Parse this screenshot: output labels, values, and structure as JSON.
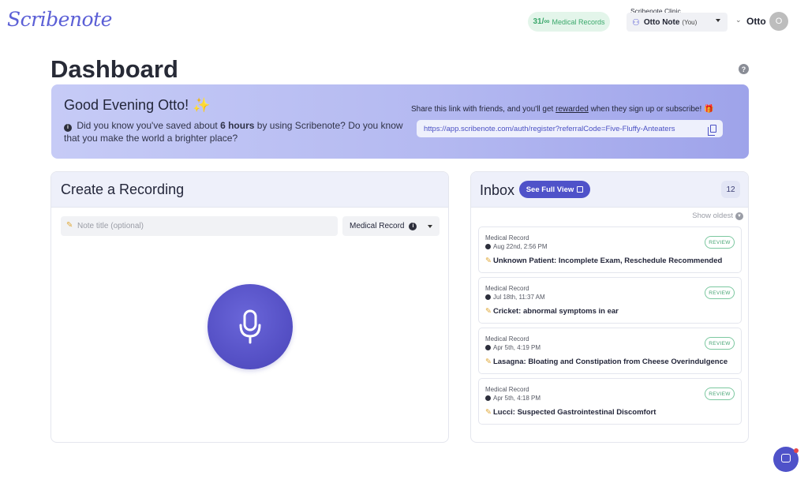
{
  "header": {
    "logo": "Scribenote",
    "records_count": "31/∞",
    "records_label": "Medical Records",
    "clinic_label": "Scribenote Clinic",
    "clinic_user": "Otto Note",
    "clinic_you": "(You)",
    "user_name": "Otto",
    "avatar_initial": "O"
  },
  "page": {
    "title": "Dashboard",
    "help_icon": "?"
  },
  "banner": {
    "greeting": "Good Evening Otto!",
    "greeting_emoji": "✨",
    "info_prefix": "Did you know you've saved about",
    "hours": "6 hours",
    "info_suffix": "by using Scribenote? Do you know that you make the world a brighter place?",
    "share_prefix": "Share this link with friends, and you'll get",
    "share_link_word": "rewarded",
    "share_suffix": "when they sign up or subscribe!",
    "gift_emoji": "🎁",
    "referral_url": "https://app.scribenote.com/auth/register?referralCode=Five-Fluffy-Anteaters"
  },
  "recording": {
    "title": "Create a Recording",
    "note_placeholder": "Note title (optional)",
    "record_type": "Medical Record"
  },
  "inbox": {
    "title": "Inbox",
    "full_view_label": "See Full View",
    "count": "12",
    "show_oldest": "Show oldest",
    "items": [
      {
        "type": "Medical Record",
        "date": "Aug 22nd, 2:56 PM",
        "title": "Unknown Patient: Incomplete Exam, Reschedule Recommended",
        "badge": "REVIEW"
      },
      {
        "type": "Medical Record",
        "date": "Jul 18th, 11:37 AM",
        "title": "Cricket: abnormal symptoms in ear",
        "badge": "REVIEW"
      },
      {
        "type": "Medical Record",
        "date": "Apr 5th, 4:19 PM",
        "title": "Lasagna: Bloating and Constipation from Cheese Overindulgence",
        "badge": "REVIEW"
      },
      {
        "type": "Medical Record",
        "date": "Apr 5th, 4:18 PM",
        "title": "Lucci: Suspected Gastrointestinal Discomfort",
        "badge": "REVIEW"
      }
    ]
  },
  "colors": {
    "brand": "#5b5fd6",
    "button": "#4f52c9",
    "review_green": "#48a575"
  }
}
